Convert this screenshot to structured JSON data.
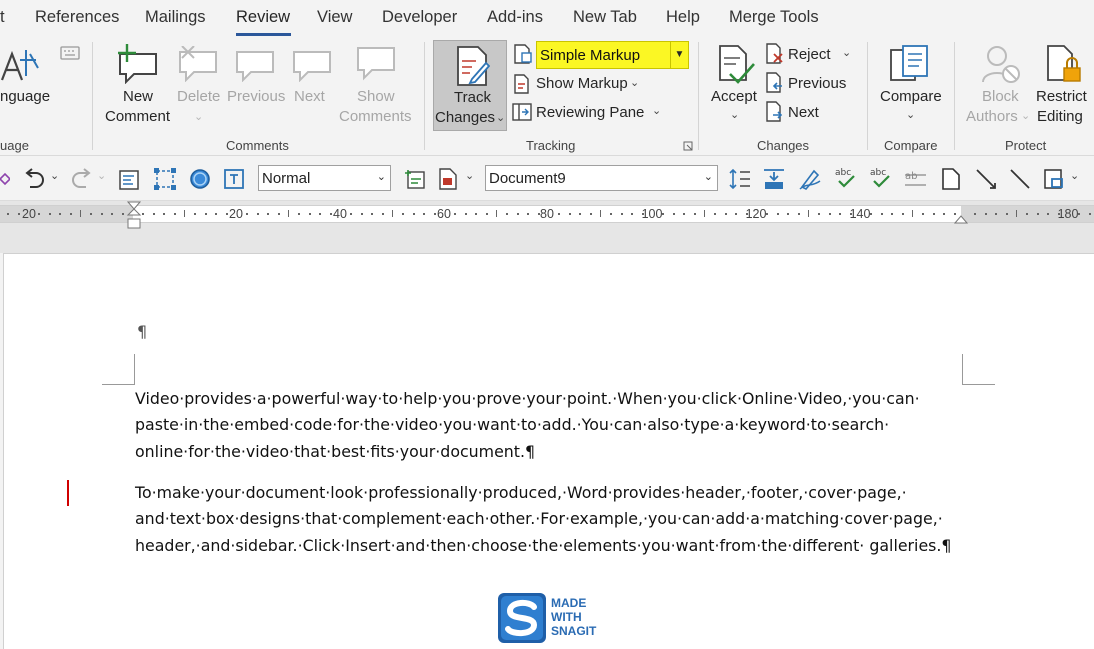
{
  "menu_tabs": [
    {
      "label": "t"
    },
    {
      "label": "References"
    },
    {
      "label": "Mailings"
    },
    {
      "label": "Review",
      "active": true
    },
    {
      "label": "View"
    },
    {
      "label": "Developer"
    },
    {
      "label": "Add-ins"
    },
    {
      "label": "New Tab"
    },
    {
      "label": "Help"
    },
    {
      "label": "Merge Tools"
    }
  ],
  "ribbon": {
    "language": {
      "label": "nguage",
      "group": "uage"
    },
    "comments": {
      "group": "Comments",
      "new_comment": [
        "New",
        "Comment"
      ],
      "delete": "Delete",
      "previous": "Previous",
      "next": "Next",
      "show_comments": [
        "Show",
        "Comments"
      ]
    },
    "tracking": {
      "group": "Tracking",
      "track_changes": [
        "Track",
        "Changes"
      ],
      "markup_value": "Simple Markup",
      "show_markup": "Show Markup",
      "reviewing_pane": "Reviewing Pane"
    },
    "changes": {
      "group": "Changes",
      "accept": "Accept",
      "reject": "Reject",
      "previous": "Previous",
      "next": "Next"
    },
    "compare": {
      "group": "Compare",
      "compare": "Compare"
    },
    "protect": {
      "group": "Protect",
      "block_authors": [
        "Block",
        "Authors"
      ],
      "restrict_editing": [
        "Restrict",
        "Editing"
      ]
    }
  },
  "toolbar": {
    "style_value": "Normal",
    "document_value": "Document9"
  },
  "ruler": {
    "labels": [
      "20",
      "20",
      "40",
      "60",
      "80",
      "100",
      "120",
      "140",
      "180"
    ]
  },
  "document": {
    "empty_para_mark": "¶",
    "paragraphs": [
      "Video·provides·a·powerful·way·to·help·you·prove·your·point.·When·you·click·Online·Video,·you·can· paste·in·the·embed·code·for·the·video·you·want·to·add.·You·can·also·type·a·keyword·to·search· online·for·the·video·that·best·fits·your·document.¶",
      "To·make·your·document·look·professionally·produced,·Word·provides·header,·footer,·cover·page,· and·text·box·designs·that·complement·each·other.·For·example,·you·can·add·a·matching·cover·page,· header,·and·sidebar.·Click·Insert·and·then·choose·the·elements·you·want·from·the·different· galleries.¶"
    ]
  },
  "watermark": {
    "lines": [
      "MADE",
      "WITH",
      "SNAGIT"
    ]
  },
  "colors": {
    "accent": "#2b579a",
    "highlight": "#fbf724",
    "change_bar": "#d00000"
  }
}
